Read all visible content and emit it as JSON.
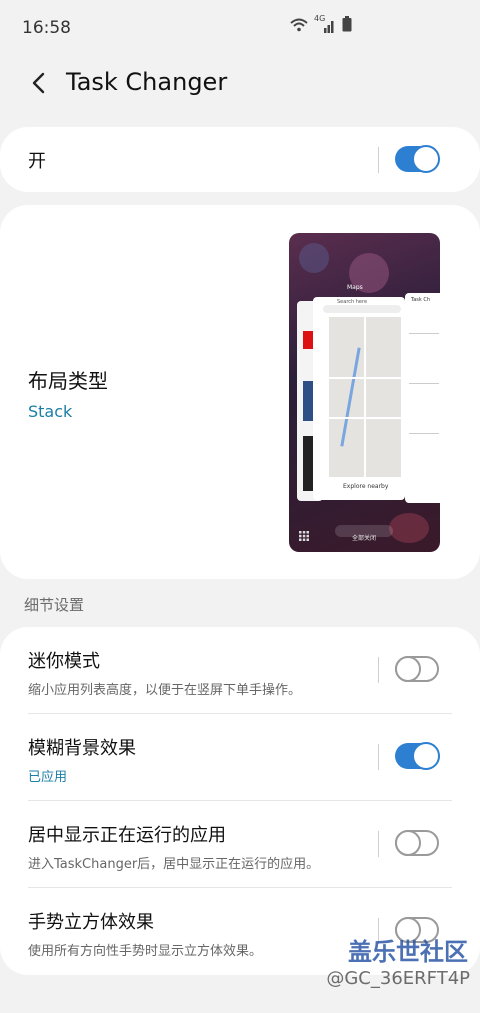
{
  "status": {
    "time": "16:58",
    "network": "4G"
  },
  "header": {
    "title": "Task Changer"
  },
  "master": {
    "label": "开",
    "enabled": true
  },
  "layout": {
    "label": "布局类型",
    "value": "Stack",
    "preview": {
      "maps_label": "Maps",
      "search_label": "Search here",
      "explore_label": "Explore nearby",
      "task_label": "Task Ch",
      "button_label": "全部关闭"
    }
  },
  "section_title": "细节设置",
  "settings": [
    {
      "label": "迷你模式",
      "desc": "缩小应用列表高度，以便于在竖屏下单手操作。",
      "enabled": false
    },
    {
      "label": "模糊背景效果",
      "desc": "已应用",
      "enabled": true
    },
    {
      "label": "居中显示正在运行的应用",
      "desc": "进入TaskChanger后，居中显示正在运行的应用。",
      "enabled": false
    },
    {
      "label": "手势立方体效果",
      "desc": "使用所有方向性手势时显示立方体效果。",
      "enabled": false
    }
  ],
  "watermark": {
    "line1": "盖乐世社区",
    "line2": "@GC_36ERFT4P"
  },
  "colors": {
    "accent": "#2d7fd1",
    "link": "#1a7fa5"
  }
}
